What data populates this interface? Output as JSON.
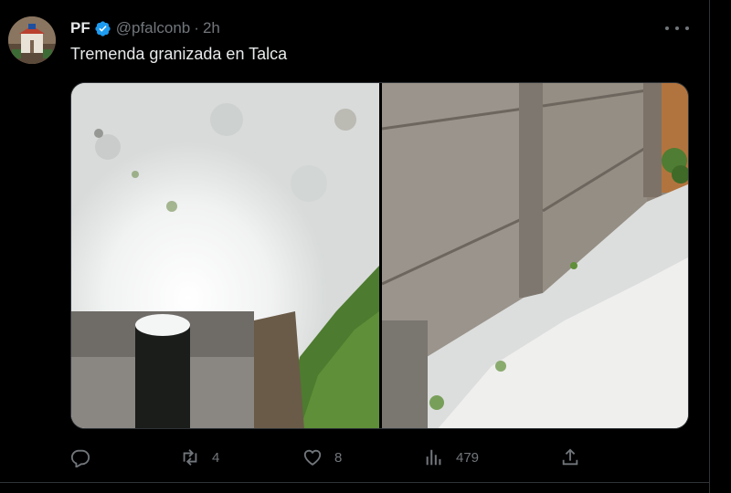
{
  "tweet": {
    "display_name": "PF",
    "handle": "@pfalconb",
    "separator": "·",
    "time": "2h",
    "text": "Tremenda granizada en Talca",
    "verified": true
  },
  "media": {
    "images": [
      {
        "subject": "hail covering ground near drain"
      },
      {
        "subject": "hail along concrete wall"
      }
    ]
  },
  "actions": {
    "reply": {
      "icon": "reply-icon",
      "count": ""
    },
    "retweet": {
      "icon": "retweet-icon",
      "count": "4"
    },
    "like": {
      "icon": "heart-icon",
      "count": "8"
    },
    "views": {
      "icon": "views-icon",
      "count": "479"
    },
    "share": {
      "icon": "share-icon"
    }
  },
  "colors": {
    "background": "#000000",
    "text": "#e7e9ea",
    "muted": "#71767b",
    "verified": "#1d9bf0",
    "border": "#2f3336"
  }
}
